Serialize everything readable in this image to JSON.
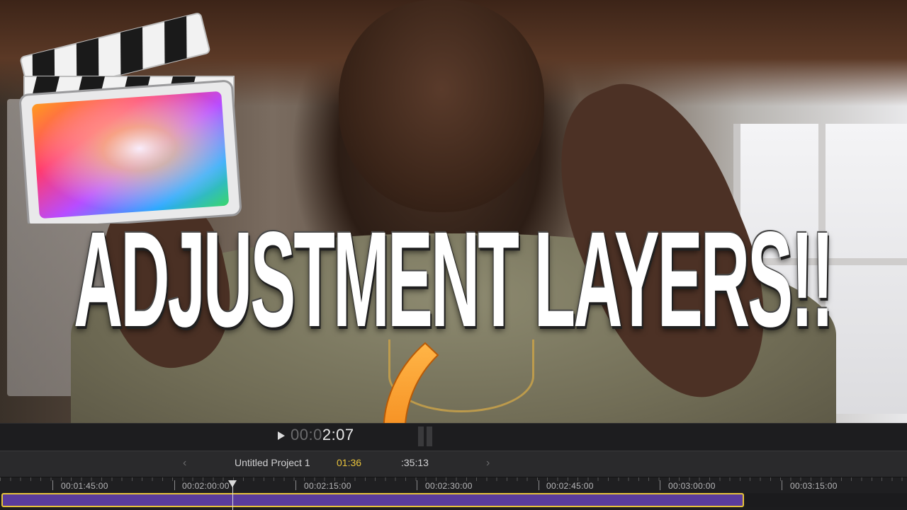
{
  "thumbnail": {
    "title": "ADJUSTMENT LAYERS!!",
    "logo_icon": "final-cut-pro-clapperboard-icon"
  },
  "viewer": {
    "play_icon": "play-icon",
    "timecode_dim": "00:0",
    "timecode_bright": "2:07"
  },
  "project_bar": {
    "back_icon": "chevron-left-icon",
    "name": "Untitled Project 1",
    "selected_duration": "01:36",
    "total_duration": ":35:13",
    "forward_icon": "chevron-right-icon"
  },
  "ruler": {
    "labels": [
      "00:01:45:00",
      "00:02:00:00",
      "00:02:15:00",
      "00:02:30:00",
      "00:02:45:00",
      "00:03:00:00",
      "00:03:15:00"
    ]
  },
  "colors": {
    "clip_fill": "#5a3c9c",
    "clip_selection": "#e6c33a",
    "arrow": "#f39a1c",
    "timeline_bg": "#1c1c1e"
  }
}
